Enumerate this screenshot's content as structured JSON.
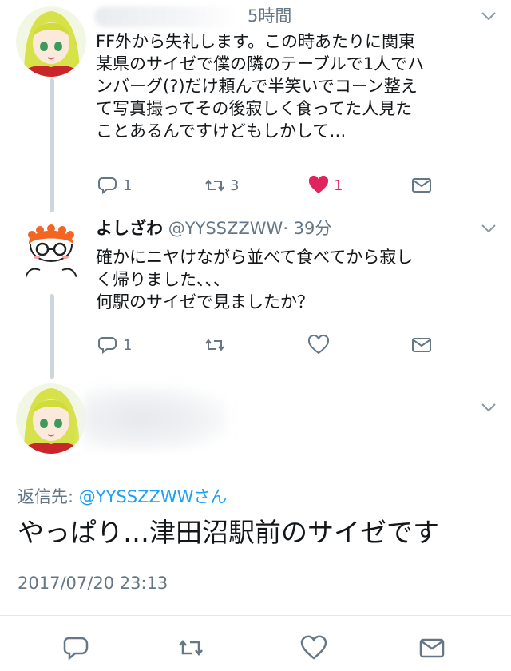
{
  "tweet1": {
    "time": "5時間",
    "text": "FF外から失礼します。この時あたりに関東\n某県のサイゼで僕の隣のテーブルで1人でハ\nンバーグ(?)だけ頼んで半笑いでコーン整え\nて写真撮ってその後寂しく食ってた人見た\nことあるんですけどもしかして…",
    "reply_count": "1",
    "retweet_count": "3",
    "like_count": "1"
  },
  "tweet2": {
    "display_name": "よしざわ",
    "handle": "@YYSSZZWW",
    "time": "· 39分",
    "text": "確かにニヤけながら並べて食べてから寂し\nく帰りました、、、\n何駅のサイゼで見ましたか？",
    "reply_count": "1"
  },
  "tweet3": {
    "reply_to_label": "返信先:",
    "reply_to_mention": "@YYSSZZWWさん",
    "text": "やっぱり…津田沼駅前のサイゼです",
    "timestamp": "2017/07/20 23:13"
  },
  "colors": {
    "like": "#e0245e",
    "link": "#1da1f2",
    "muted": "#657786",
    "thread_line": "#ccd6dd"
  },
  "icons": [
    "reply-icon",
    "retweet-icon",
    "heart-icon",
    "dm-icon",
    "chevron-down-icon"
  ]
}
